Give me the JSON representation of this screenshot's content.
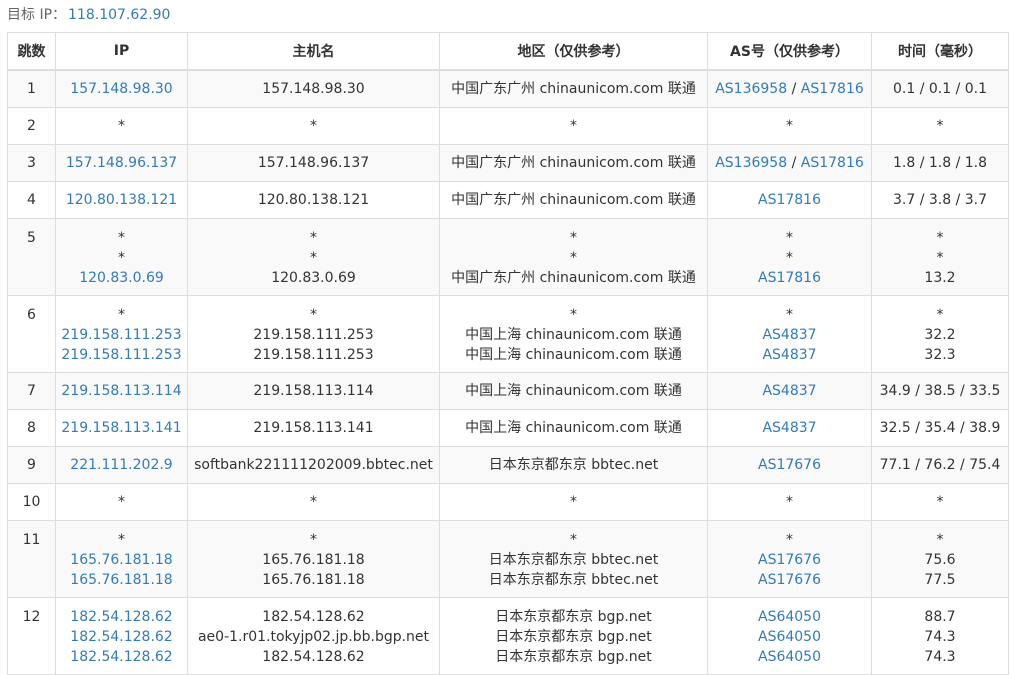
{
  "target": {
    "label": "目标 IP：",
    "ip": "118.107.62.90"
  },
  "headers": [
    "跳数",
    "IP",
    "主机名",
    "地区（仅供参考）",
    "AS号（仅供参考）",
    "时间（毫秒）"
  ],
  "rows": [
    {
      "hop": "1",
      "ips": [
        "157.148.98.30"
      ],
      "hosts": [
        "157.148.98.30"
      ],
      "regions": [
        "中国广东广州 chinaunicom.com 联通"
      ],
      "as": [
        [
          "AS136958",
          "AS17816"
        ]
      ],
      "times": [
        "0.1 / 0.1 / 0.1"
      ]
    },
    {
      "hop": "2",
      "ips": [
        "*"
      ],
      "hosts": [
        "*"
      ],
      "regions": [
        "*"
      ],
      "as": [
        [
          "*"
        ]
      ],
      "times": [
        "*"
      ]
    },
    {
      "hop": "3",
      "ips": [
        "157.148.96.137"
      ],
      "hosts": [
        "157.148.96.137"
      ],
      "regions": [
        "中国广东广州 chinaunicom.com 联通"
      ],
      "as": [
        [
          "AS136958",
          "AS17816"
        ]
      ],
      "times": [
        "1.8 / 1.8 / 1.8"
      ]
    },
    {
      "hop": "4",
      "ips": [
        "120.80.138.121"
      ],
      "hosts": [
        "120.80.138.121"
      ],
      "regions": [
        "中国广东广州 chinaunicom.com 联通"
      ],
      "as": [
        [
          "AS17816"
        ]
      ],
      "times": [
        "3.7 / 3.8 / 3.7"
      ]
    },
    {
      "hop": "5",
      "ips": [
        "*",
        "*",
        "120.83.0.69"
      ],
      "hosts": [
        "*",
        "*",
        "120.83.0.69"
      ],
      "regions": [
        "*",
        "*",
        "中国广东广州 chinaunicom.com 联通"
      ],
      "as": [
        [
          "*"
        ],
        [
          "*"
        ],
        [
          "AS17816"
        ]
      ],
      "times": [
        "*",
        "*",
        "13.2"
      ]
    },
    {
      "hop": "6",
      "ips": [
        "*",
        "219.158.111.253",
        "219.158.111.253"
      ],
      "hosts": [
        "*",
        "219.158.111.253",
        "219.158.111.253"
      ],
      "regions": [
        "*",
        "中国上海 chinaunicom.com 联通",
        "中国上海 chinaunicom.com 联通"
      ],
      "as": [
        [
          "*"
        ],
        [
          "AS4837"
        ],
        [
          "AS4837"
        ]
      ],
      "times": [
        "*",
        "32.2",
        "32.3"
      ]
    },
    {
      "hop": "7",
      "ips": [
        "219.158.113.114"
      ],
      "hosts": [
        "219.158.113.114"
      ],
      "regions": [
        "中国上海 chinaunicom.com 联通"
      ],
      "as": [
        [
          "AS4837"
        ]
      ],
      "times": [
        "34.9 / 38.5 / 33.5"
      ]
    },
    {
      "hop": "8",
      "ips": [
        "219.158.113.141"
      ],
      "hosts": [
        "219.158.113.141"
      ],
      "regions": [
        "中国上海 chinaunicom.com 联通"
      ],
      "as": [
        [
          "AS4837"
        ]
      ],
      "times": [
        "32.5 / 35.4 / 38.9"
      ]
    },
    {
      "hop": "9",
      "ips": [
        "221.111.202.9"
      ],
      "hosts": [
        "softbank221111202009.bbtec.net"
      ],
      "regions": [
        "日本东京都东京 bbtec.net"
      ],
      "as": [
        [
          "AS17676"
        ]
      ],
      "times": [
        "77.1 / 76.2 / 75.4"
      ]
    },
    {
      "hop": "10",
      "ips": [
        "*"
      ],
      "hosts": [
        "*"
      ],
      "regions": [
        "*"
      ],
      "as": [
        [
          "*"
        ]
      ],
      "times": [
        "*"
      ]
    },
    {
      "hop": "11",
      "ips": [
        "*",
        "165.76.181.18",
        "165.76.181.18"
      ],
      "hosts": [
        "*",
        "165.76.181.18",
        "165.76.181.18"
      ],
      "regions": [
        "*",
        "日本东京都东京 bbtec.net",
        "日本东京都东京 bbtec.net"
      ],
      "as": [
        [
          "*"
        ],
        [
          "AS17676"
        ],
        [
          "AS17676"
        ]
      ],
      "times": [
        "*",
        "75.6",
        "77.5"
      ]
    },
    {
      "hop": "12",
      "ips": [
        "182.54.128.62",
        "182.54.128.62",
        "182.54.128.62"
      ],
      "hosts": [
        "182.54.128.62",
        "ae0-1.r01.tokyjp02.jp.bb.bgp.net",
        "182.54.128.62"
      ],
      "regions": [
        "日本东京都东京 bgp.net",
        "日本东京都东京 bgp.net",
        "日本东京都东京 bgp.net"
      ],
      "as": [
        [
          "AS64050"
        ],
        [
          "AS64050"
        ],
        [
          "AS64050"
        ]
      ],
      "times": [
        "88.7",
        "74.3",
        "74.3"
      ]
    }
  ]
}
